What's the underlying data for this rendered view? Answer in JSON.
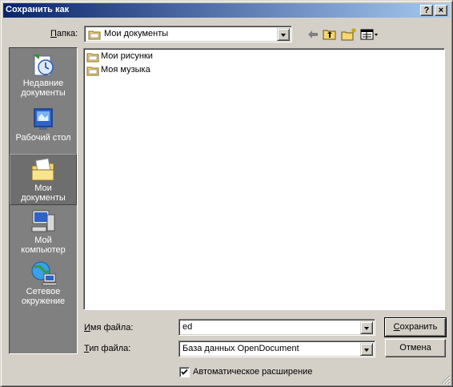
{
  "window": {
    "title": "Сохранить как",
    "help_button": "?",
    "close_button": "×"
  },
  "toolbar": {
    "folder_label_u": "П",
    "folder_label_rest": "апка:",
    "folder_value": "Мои документы",
    "tools": [
      "back-icon",
      "up-folder-icon",
      "new-folder-icon",
      "view-menu-icon"
    ]
  },
  "places": [
    {
      "line1": "Недавние",
      "line2": "документы",
      "icon": "recent-documents-icon"
    },
    {
      "line1": "Рабочий стол",
      "line2": "",
      "icon": "desktop-icon"
    },
    {
      "line1": "Мои",
      "line2": "документы",
      "icon": "my-documents-icon",
      "selected": true
    },
    {
      "line1": "Мой",
      "line2": "компьютер",
      "icon": "my-computer-icon"
    },
    {
      "line1": "Сетевое",
      "line2": "окружение",
      "icon": "network-icon"
    }
  ],
  "files": [
    {
      "name": "Мои рисунки",
      "icon": "folder-icon"
    },
    {
      "name": "Моя музыка",
      "icon": "folder-icon"
    }
  ],
  "filename": {
    "label_u": "И",
    "label_rest": "мя файла:",
    "value": "ed"
  },
  "filetype": {
    "label_u": "Т",
    "label_rest": "ип файла:",
    "value": "База данных OpenDocument"
  },
  "buttons": {
    "save_u": "С",
    "save_rest": "охранить",
    "cancel": "Отмена"
  },
  "auto_extension": {
    "checked": true,
    "label": "Автоматическое расширение"
  },
  "colors": {
    "title_gradient_start": "#0a246a",
    "title_gradient_end": "#a6caf0",
    "dialog_face": "#d4d0c8",
    "places_bar": "#808080"
  }
}
